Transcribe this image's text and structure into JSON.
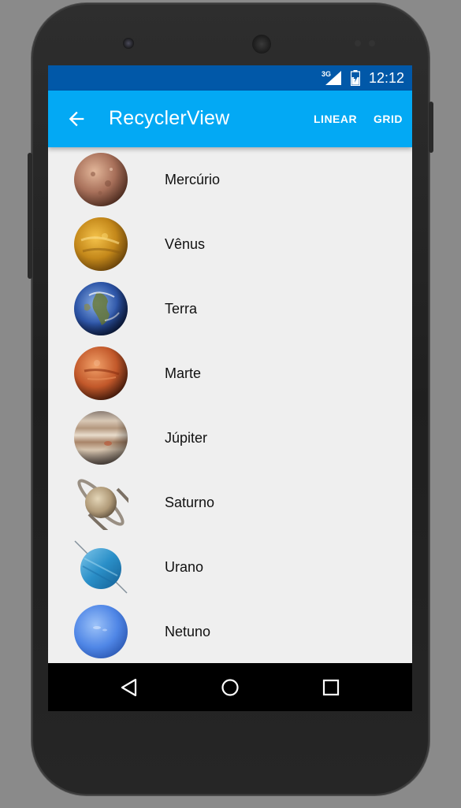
{
  "status_bar": {
    "network": "3G",
    "time": "12:12"
  },
  "app_bar": {
    "title": "RecyclerView",
    "back_icon": "arrow-left-icon",
    "actions": [
      {
        "label": "LINEAR"
      },
      {
        "label": "GRID"
      }
    ]
  },
  "planets": [
    {
      "name": "Mercúrio"
    },
    {
      "name": "Vênus"
    },
    {
      "name": "Terra"
    },
    {
      "name": "Marte"
    },
    {
      "name": "Júpiter"
    },
    {
      "name": "Saturno"
    },
    {
      "name": "Urano"
    },
    {
      "name": "Netuno"
    }
  ],
  "nav_bar": {
    "icons": [
      "back-triangle-icon",
      "home-circle-icon",
      "recents-square-icon"
    ]
  },
  "colors": {
    "status_bar": "#0158a8",
    "app_bar": "#03a9f4",
    "list_background": "#efefef",
    "nav_bar": "#000000"
  }
}
